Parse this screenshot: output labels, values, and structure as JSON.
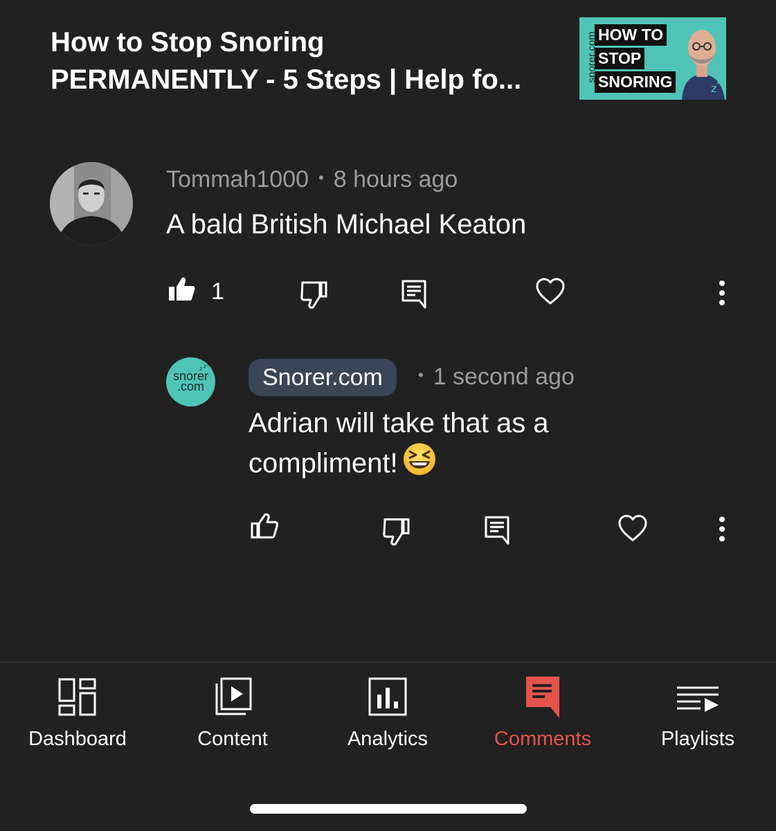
{
  "video": {
    "title": "How to Stop Snoring\nPERMANENTLY - 5 Steps | Help fo...",
    "thumbnail": {
      "side_text": "snorer.com",
      "lines": [
        "HOW TO",
        "STOP",
        "SNORING"
      ],
      "accent": "#4fc4b6"
    }
  },
  "comment": {
    "author": "Tommah1000",
    "separator": "•",
    "time": "8 hours ago",
    "text": "A bald British Michael Keaton",
    "like_count": "1",
    "liked": true
  },
  "reply": {
    "author": "Snorer.com",
    "avatar_text": "snorer\n.com",
    "separator": "•",
    "time": "1 second ago",
    "text": "Adrian will take that as a compliment!",
    "emoji": "grinning-squinting-face"
  },
  "nav": {
    "active": "Comments",
    "active_color": "#e5534b",
    "items": [
      {
        "label": "Dashboard",
        "icon": "dashboard-icon"
      },
      {
        "label": "Content",
        "icon": "content-icon"
      },
      {
        "label": "Analytics",
        "icon": "analytics-icon"
      },
      {
        "label": "Comments",
        "icon": "comments-icon"
      },
      {
        "label": "Playlists",
        "icon": "playlists-icon"
      }
    ]
  }
}
